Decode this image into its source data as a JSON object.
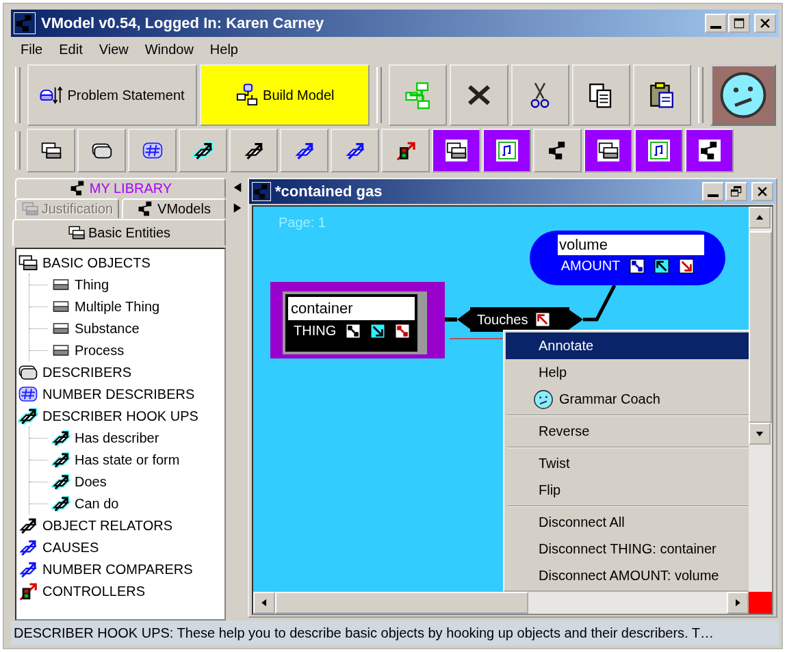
{
  "window": {
    "title": "VModel v0.54, Logged In: Karen Carney"
  },
  "menu": [
    "File",
    "Edit",
    "View",
    "Window",
    "Help"
  ],
  "mode_buttons": [
    {
      "label": "Problem Statement",
      "kind": "problem",
      "selected": false
    },
    {
      "label": "Build Model",
      "kind": "build",
      "selected": true
    }
  ],
  "tool_buttons": [
    {
      "kind": "diagram"
    },
    {
      "kind": "delete"
    },
    {
      "kind": "cut"
    },
    {
      "kind": "copy"
    },
    {
      "kind": "paste"
    }
  ],
  "palette": [
    {
      "kind": "frames",
      "highlighted": false
    },
    {
      "kind": "rounded",
      "highlighted": false
    },
    {
      "kind": "number",
      "highlighted": false
    },
    {
      "kind": "hook-cyan",
      "highlighted": false
    },
    {
      "kind": "hook-black",
      "highlighted": false
    },
    {
      "kind": "hook-blue",
      "highlighted": false
    },
    {
      "kind": "hook-blue",
      "highlighted": false
    },
    {
      "kind": "controller",
      "highlighted": false
    },
    {
      "kind": "frames",
      "highlighted": true
    },
    {
      "kind": "note",
      "highlighted": true
    },
    {
      "kind": "network",
      "highlighted": false
    },
    {
      "kind": "frames",
      "highlighted": true
    },
    {
      "kind": "note",
      "highlighted": true
    },
    {
      "kind": "network",
      "highlighted": true
    }
  ],
  "library_tabs": [
    [
      {
        "label": "MY LIBRARY",
        "kind": "network",
        "selected": false,
        "disabled": false,
        "color": "#aa00ff"
      }
    ],
    [
      {
        "label": "Justification",
        "kind": "frames",
        "selected": false,
        "disabled": true
      },
      {
        "label": "VModels",
        "kind": "network",
        "selected": false,
        "disabled": false
      }
    ],
    [
      {
        "label": "Basic Entities",
        "kind": "frames",
        "selected": true,
        "disabled": false
      }
    ]
  ],
  "tree": [
    {
      "label": "BASIC OBJECTS",
      "kind": "frames",
      "children": [
        {
          "label": "Thing",
          "kind": "entity"
        },
        {
          "label": "Multiple Thing",
          "kind": "entity"
        },
        {
          "label": "Substance",
          "kind": "entity"
        },
        {
          "label": "Process",
          "kind": "entity"
        }
      ]
    },
    {
      "label": "DESCRIBERS",
      "kind": "rounded"
    },
    {
      "label": "NUMBER DESCRIBERS",
      "kind": "number"
    },
    {
      "label": "DESCRIBER HOOK UPS",
      "kind": "hook-cyan",
      "children": [
        {
          "label": "Has describer",
          "kind": "hook-cyan"
        },
        {
          "label": "Has state or form",
          "kind": "hook-cyan"
        },
        {
          "label": "Does",
          "kind": "hook-cyan"
        },
        {
          "label": "Can do",
          "kind": "hook-cyan"
        }
      ]
    },
    {
      "label": "OBJECT RELATORS",
      "kind": "hook-black"
    },
    {
      "label": "CAUSES",
      "kind": "hook-blue"
    },
    {
      "label": "NUMBER COMPARERS",
      "kind": "hook-blue"
    },
    {
      "label": "CONTROLLERS",
      "kind": "controller"
    }
  ],
  "document": {
    "title": "*contained gas",
    "page": "Page: 1",
    "nodes": [
      {
        "kind": "thing",
        "label": "container",
        "type": "THING",
        "selected": true
      },
      {
        "kind": "amount",
        "label": "volume",
        "type": "AMOUNT",
        "selected": false
      }
    ],
    "link": {
      "label": "Touches"
    }
  },
  "context_menu": [
    [
      {
        "label": "Annotate",
        "kind": "plain",
        "selected": true
      },
      {
        "label": "Help",
        "kind": "plain",
        "selected": false
      },
      {
        "label": "Grammar Coach",
        "kind": "coach",
        "selected": false
      }
    ],
    [
      {
        "label": "Reverse",
        "kind": "plain",
        "selected": false
      }
    ],
    [
      {
        "label": "Twist",
        "kind": "plain",
        "selected": false
      },
      {
        "label": "Flip",
        "kind": "plain",
        "selected": false
      }
    ],
    [
      {
        "label": "Disconnect All",
        "kind": "plain",
        "selected": false
      },
      {
        "label": "Disconnect THING: container",
        "kind": "plain",
        "selected": false
      },
      {
        "label": "Disconnect AMOUNT: volume",
        "kind": "plain",
        "selected": false
      }
    ]
  ],
  "status_bar": "DESCRIBER HOOK UPS: These help you to describe basic objects by hooking up objects and their describers.  T…"
}
